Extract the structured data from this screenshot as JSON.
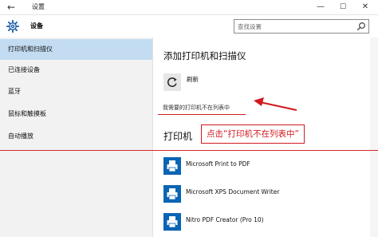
{
  "titlebar": {
    "back_icon": "back-arrow-icon",
    "title": "设置",
    "controls": {
      "minimize": "—",
      "maximize": "☐",
      "close": "✕"
    }
  },
  "header": {
    "icon": "gear-icon",
    "title": "设备",
    "search": {
      "placeholder": "查找设置",
      "icon": "search-icon"
    }
  },
  "sidebar": {
    "items": [
      {
        "label": "打印机和扫描仪",
        "active": true
      },
      {
        "label": "已连接设备",
        "active": false
      },
      {
        "label": "蓝牙",
        "active": false
      },
      {
        "label": "鼠标和触摸板",
        "active": false
      },
      {
        "label": "自动播放",
        "active": false
      }
    ]
  },
  "main": {
    "title": "添加打印机和扫描仪",
    "refresh": {
      "label": "刷新",
      "icon": "refresh-icon"
    },
    "not_listed_link": "我需要的打印机不在列表中",
    "printers_title": "打印机",
    "printers": [
      {
        "name": "Microsoft Print to PDF",
        "icon": "printer-icon"
      },
      {
        "name": "Microsoft XPS Document Writer",
        "icon": "printer-icon"
      },
      {
        "name": "Nitro PDF Creator (Pro 10)",
        "icon": "printer-icon"
      }
    ]
  },
  "annotation": {
    "callout_text": "点击“打印机不在列表中”",
    "color": "#d2191f"
  },
  "colors": {
    "accent": "#0a64b4",
    "sidebar_active": "#c3dcf2",
    "sidebar_bg": "#f2f2f2"
  }
}
